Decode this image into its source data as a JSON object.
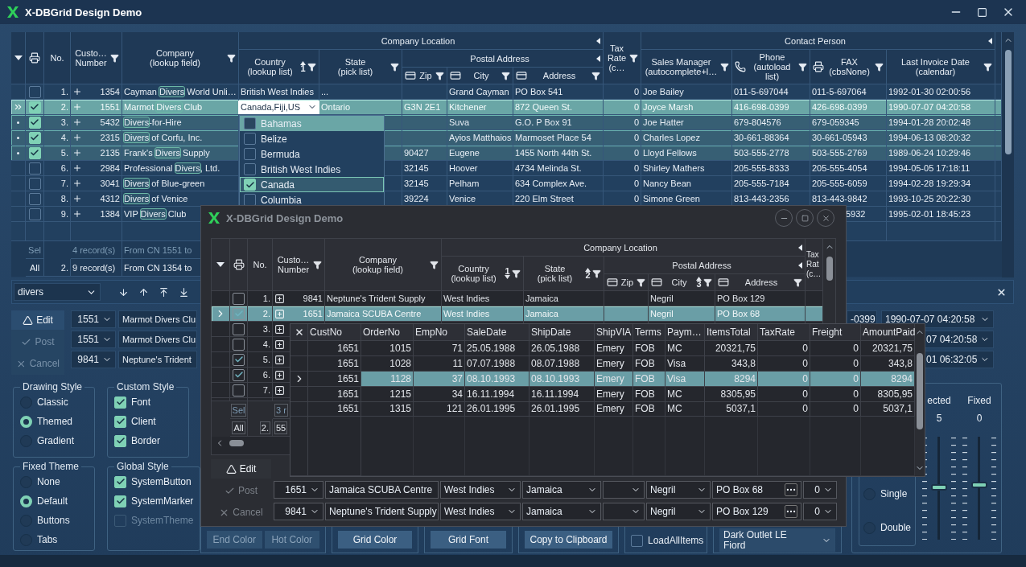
{
  "window": {
    "title": "X-DBGrid Design Demo"
  },
  "grid": {
    "header": [
      {
        "label": "No."
      },
      {
        "label": "Custo…\nNumber",
        "filter": true
      },
      {
        "label": "Company\n(lookup field)",
        "filter": true
      },
      {
        "label": "Company Location",
        "children": [
          {
            "label": "Country\n(lookup list)",
            "filter": true,
            "sort": "1",
            "descending": false
          },
          {
            "label": "State\n(pick list)",
            "filter": true
          },
          {
            "label": "Postal Address",
            "children": [
              {
                "label": "Zip",
                "filter": true,
                "kind": "card"
              },
              {
                "label": "City",
                "filter": true,
                "kind": "card"
              },
              {
                "label": "Address",
                "filter": true,
                "kind": "card"
              }
            ]
          }
        ]
      },
      {
        "label": "Tax\nRate\n(c…",
        "filter": true
      },
      {
        "label": "Contact Person",
        "children": [
          {
            "label": "Sales Manager\n(autocomplete+l…",
            "filter": true
          },
          {
            "label": "Phone\n(autoload\nlist)",
            "filter": true,
            "kind": "phone"
          },
          {
            "label": "FAX\n(cbsNone)",
            "filter": true,
            "kind": "fax"
          },
          {
            "label": "Last Invoice Date\n(calendar)",
            "filter": true
          }
        ]
      }
    ],
    "rows": [
      {
        "current": false,
        "selected": false,
        "checked": false,
        "cells": [
          "1.",
          "1354",
          "Cayman **Divers** World Unli…",
          "British West Indies",
          "...",
          null,
          "Grand Cayman",
          "PO Box 541",
          "0",
          "Joe Bailey",
          "011-5-697044",
          "011-5-697064",
          "1992-01-30 02:00:56"
        ]
      },
      {
        "current": true,
        "selected": true,
        "checked": true,
        "cells": [
          "2.",
          "1551",
          "Marmot **Divers** Club",
          {
            "kind": "editor",
            "text": "Canada,Fiji,US"
          },
          "Ontario",
          "G3N 2E1",
          "Kitchener",
          "872 Queen St.",
          "0",
          "Joyce Marsh",
          "416-698-0399",
          "426-698-0399",
          "1990-07-07 04:20:58"
        ]
      },
      {
        "current": false,
        "selected": true,
        "checked": true,
        "cells": [
          "3.",
          "5432",
          "**Divers**-for-Hire",
          null,
          null,
          null,
          "Suva",
          "G.O. P Box 91",
          "0",
          "Joe Hatter",
          "679-804576",
          "679-059345",
          "1994-01-28 20:02:48"
        ]
      },
      {
        "current": false,
        "selected": true,
        "checked": true,
        "cells": [
          "4.",
          "2315",
          "**Divers** of Corfu, Inc.",
          null,
          null,
          null,
          "Ayios Matthaios",
          "Marmoset Place 54",
          "0",
          "Charles Lopez",
          "30-661-88364",
          "30-661-05943",
          "1994-06-13 08:20:32"
        ]
      },
      {
        "current": false,
        "selected": true,
        "checked": true,
        "cells": [
          "5.",
          "2135",
          "Frank's **Divers** Supply",
          null,
          null,
          "90427",
          "Eugene",
          "1455 North 44th St.",
          "0",
          "Lloyd Fellows",
          "503-555-2778",
          "503-555-2769",
          "1989-06-24 10:29:46"
        ]
      },
      {
        "current": false,
        "selected": false,
        "checked": false,
        "cells": [
          "6.",
          "2984",
          "Professional **Divers**, Ltd.",
          null,
          null,
          "32145",
          "Hoover",
          "4734 Melinda St.",
          "0",
          "Shirley Mathers",
          "205-555-8333",
          "205-555-4054",
          "1994-05-05 17:18:11"
        ]
      },
      {
        "current": false,
        "selected": false,
        "checked": false,
        "cells": [
          "7.",
          "3041",
          "**Divers** of Blue-green",
          null,
          null,
          "32145",
          "Pelham",
          "634 Complex Ave.",
          "0",
          "Nancy Bean",
          "205-555-7184",
          "205-555-6059",
          "1994-02-28 19:29:34"
        ]
      },
      {
        "current": false,
        "selected": false,
        "checked": false,
        "cells": [
          "8.",
          "4312",
          "**Divers** of Venice",
          null,
          null,
          "39224",
          "Venice",
          "220 Elm Street",
          "0",
          "Simone Green",
          "813-443-2356",
          "813-443-9842",
          "1993-10-25 20:22:30"
        ]
      },
      {
        "current": false,
        "selected": false,
        "checked": false,
        "cells": [
          "9.",
          "1384",
          "VIP **Divers** Club",
          null,
          null,
          null,
          null,
          null,
          null,
          null,
          null,
          {
            "kind": "clipped",
            "text": "5932"
          },
          "1995-02-01 18:45:23"
        ]
      }
    ],
    "footer": [
      {
        "label": "Sel",
        "dimmed": true,
        "cells": [
          null,
          "4 record(s)",
          "From CN 1551 to"
        ]
      },
      {
        "label": "All",
        "dimmed": false,
        "cells": [
          "2.",
          "9 record(s)",
          "From CN 1354 to"
        ]
      }
    ]
  },
  "country_dropdown": [
    {
      "label": "Bahamas",
      "checked": false,
      "selected": true,
      "focused": false
    },
    {
      "label": "Belize",
      "checked": false,
      "selected": false,
      "focused": false
    },
    {
      "label": "Bermuda",
      "checked": false,
      "selected": false,
      "focused": false
    },
    {
      "label": "British West Indies",
      "checked": false,
      "selected": false,
      "focused": false
    },
    {
      "label": "Canada",
      "checked": true,
      "selected": false,
      "focused": true
    },
    {
      "label": "Columbia",
      "checked": false,
      "selected": false,
      "focused": false
    }
  ],
  "search": {
    "value": "divers"
  },
  "edit_panel": {
    "buttons": [
      {
        "label": "Edit",
        "kind": "edit",
        "disabled": false
      },
      {
        "label": "Post",
        "kind": "post",
        "disabled": true
      },
      {
        "label": "Cancel",
        "kind": "cancel",
        "disabled": true
      }
    ],
    "rows": [
      [
        "1551",
        "Marmot Divers Clu"
      ],
      [
        "1551",
        "Marmot Divers Clu"
      ],
      [
        "9841",
        "Neptune's Trident"
      ]
    ],
    "right_rows": [
      [
        "-0399",
        "1990-07-07 04:20:58"
      ],
      [
        "07 04:20:58"
      ],
      [
        "01 06:32:05"
      ]
    ]
  },
  "drawing_style": {
    "title": "Drawing Style",
    "options": [
      {
        "label": "Classic",
        "selected": false
      },
      {
        "label": "Themed",
        "selected": true
      },
      {
        "label": "Gradient",
        "selected": false
      }
    ]
  },
  "custom_style": {
    "title": "Custom Style",
    "options": [
      {
        "label": "Font",
        "checked": true,
        "disabled": false
      },
      {
        "label": "Client",
        "checked": true,
        "disabled": false
      },
      {
        "label": "Border",
        "checked": true,
        "disabled": false
      }
    ]
  },
  "fixed_theme": {
    "title": "Fixed Theme",
    "options": [
      {
        "label": "None",
        "selected": false
      },
      {
        "label": "Default",
        "selected": true
      },
      {
        "label": "Buttons",
        "selected": false
      },
      {
        "label": "Tabs",
        "selected": false
      }
    ]
  },
  "global_style": {
    "title": "Global Style",
    "options": [
      {
        "label": "SystemButton",
        "checked": true,
        "disabled": false
      },
      {
        "label": "SystemMarker",
        "checked": true,
        "disabled": false
      },
      {
        "label": "SystemTheme",
        "checked": false,
        "disabled": true
      }
    ]
  },
  "bottom_groups": [
    {
      "buttons": [
        {
          "label": "End Color",
          "disabled": true
        },
        {
          "label": "Hot Color",
          "disabled": true
        }
      ]
    },
    {
      "buttons": [
        {
          "label": "Grid Color",
          "disabled": false
        }
      ]
    },
    {
      "buttons": [
        {
          "label": "Grid Font",
          "disabled": false
        }
      ]
    },
    {
      "buttons": [
        {
          "label": "Copy to Clipboard",
          "disabled": false
        }
      ]
    }
  ],
  "load_all": {
    "label": "LoadAllItems",
    "checked": false
  },
  "theme_list": {
    "lines": [
      "Dark Outlet LE",
      "Fiord"
    ]
  },
  "line_style": [
    {
      "label": "Single",
      "selected": false
    },
    {
      "label": "Double",
      "selected": false
    }
  ],
  "sliders": [
    {
      "label": "ected",
      "value": "5",
      "level": 0.5
    },
    {
      "label": "Fixed",
      "value": "0",
      "level": 0.52
    }
  ],
  "second_window": {
    "title": "X-DBGrid Design Demo",
    "grid": {
      "header": [
        {
          "label": "No."
        },
        {
          "label": "Custo…\nNumber",
          "filter": true
        },
        {
          "label": "Company\n(lookup field)",
          "filter": true
        },
        {
          "label": "Company Location",
          "children": [
            {
              "label": "Country\n(lookup list)",
              "filter": true,
              "sort": "1",
              "descending": true
            },
            {
              "label": "State\n(pick list)",
              "filter": true,
              "sort": "2",
              "descending": false
            },
            {
              "label": "Postal Address",
              "children": [
                {
                  "label": "Zip",
                  "filter": true,
                  "kind": "card"
                },
                {
                  "label": "City",
                  "filter": true,
                  "kind": "card",
                  "sort": "3",
                  "descending": false
                },
                {
                  "label": "Address",
                  "filter": true,
                  "kind": "card"
                }
              ]
            }
          ]
        },
        {
          "label": "Tax\nRat\n(c…"
        }
      ],
      "rows": [
        {
          "current": false,
          "selected": false,
          "checked": false,
          "cells": [
            "1.",
            "9841",
            "Neptune's Trident Supply",
            "West Indies",
            "Jamaica",
            null,
            "Negril",
            "PO Box 129"
          ]
        },
        {
          "current": true,
          "selected": true,
          "checked": true,
          "cells": [
            "2.",
            "1651",
            "Jamaica SCUBA Centre",
            "West Indies",
            "Jamaica",
            null,
            "Negril",
            "PO Box 68"
          ]
        },
        {
          "current": false,
          "selected": false,
          "checked": false,
          "cells": [
            "3."
          ]
        },
        {
          "current": false,
          "selected": false,
          "checked": false,
          "cells": [
            "4."
          ]
        },
        {
          "current": false,
          "selected": false,
          "checked": true,
          "cells": [
            "5."
          ]
        },
        {
          "current": false,
          "selected": false,
          "checked": true,
          "cells": [
            "6."
          ]
        },
        {
          "current": false,
          "selected": false,
          "checked": false,
          "cells": [
            "7."
          ]
        }
      ],
      "footer": [
        {
          "label": "Sel",
          "dimmed": true,
          "cells": [
            null,
            "3 r"
          ]
        },
        {
          "label": "All",
          "dimmed": false,
          "cells": [
            "2.",
            "55"
          ]
        }
      ]
    },
    "detail": {
      "columns": [
        "CustNo",
        "OrderNo",
        "EmpNo",
        "SaleDate",
        "ShipDate",
        "ShipVIA",
        "Terms",
        "Paym…",
        "ItemsTotal",
        "TaxRate",
        "Freight",
        "AmountPaid"
      ],
      "rows": [
        {
          "current": false,
          "cells": [
            "1651",
            "1015",
            "71",
            "25.05.1988",
            "26.05.1988",
            "Emery",
            "FOB",
            "MC",
            "20321,75",
            "0",
            "0",
            "20321,75"
          ]
        },
        {
          "current": false,
          "cells": [
            "1651",
            "1028",
            "11",
            "07.07.1988",
            "08.07.1988",
            "Emery",
            "FOB",
            "Visa",
            "343,8",
            "0",
            "0",
            "343,8"
          ]
        },
        {
          "current": true,
          "cells": [
            "1651",
            "1128",
            "37",
            "08.10.1993",
            "08.10.1993",
            "Emery",
            "FOB",
            "Visa",
            "8294",
            "0",
            "0",
            "8294"
          ]
        },
        {
          "current": false,
          "cells": [
            "1651",
            "1215",
            "34",
            "16.11.1994",
            "16.11.1994",
            "Emery",
            "FOB",
            "MC",
            "8305,95",
            "0",
            "0",
            "8305,95"
          ]
        },
        {
          "current": false,
          "cells": [
            "1651",
            "1315",
            "121",
            "26.01.1995",
            "26.01.1995",
            "Emery",
            "FOB",
            "MC",
            "5037,1",
            "0",
            "0",
            "5037,1"
          ]
        }
      ]
    },
    "edit_panel": {
      "buttons": [
        {
          "label": "Edit",
          "kind": "edit",
          "disabled": false
        },
        {
          "label": "Post",
          "kind": "post",
          "disabled": true
        },
        {
          "label": "Cancel",
          "kind": "cancel",
          "disabled": true
        }
      ],
      "rows": [
        [
          "1651",
          "Jamaica SCUBA Centre",
          "West Indies",
          "Jamaica",
          null,
          "Negril",
          "PO Box 68",
          "0"
        ],
        [
          "9841",
          "Neptune's Trident Supply",
          "West Indies",
          "Jamaica",
          null,
          "Negril",
          "PO Box 129",
          "0"
        ]
      ]
    }
  }
}
